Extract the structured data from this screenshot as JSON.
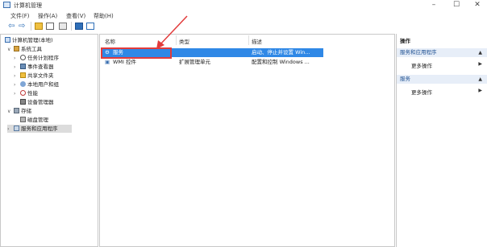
{
  "window": {
    "title": "计算机管理",
    "minimize": "–",
    "maximize": "☐",
    "close": "✕"
  },
  "menu": [
    "文件(F)",
    "操作(A)",
    "查看(V)",
    "帮助(H)"
  ],
  "tree": {
    "root": "计算机管理(本地)",
    "system_tools": "系统工具",
    "task_scheduler": "任务计划程序",
    "event_viewer": "事件查看器",
    "shared_folders": "共享文件夹",
    "local_users": "本地用户和组",
    "performance": "性能",
    "device_manager": "设备管理器",
    "storage": "存储",
    "disk_management": "磁盘管理",
    "services_apps": "服务和应用程序"
  },
  "list": {
    "columns": [
      "名称",
      "类型",
      "描述"
    ],
    "rows": [
      {
        "name": "服务",
        "type": "",
        "desc": "启动、停止并设置 Win..."
      },
      {
        "name": "WMI 控件",
        "type": "扩展管理单元",
        "desc": "配置和控制 Windows ..."
      }
    ]
  },
  "actions": {
    "header": "操作",
    "section1": "服务和应用程序",
    "section1_more": "更多操作",
    "section2": "服务",
    "section2_more": "更多操作"
  },
  "colors": {
    "selection": "#2f88e6",
    "annotation": "#e23b3b"
  }
}
